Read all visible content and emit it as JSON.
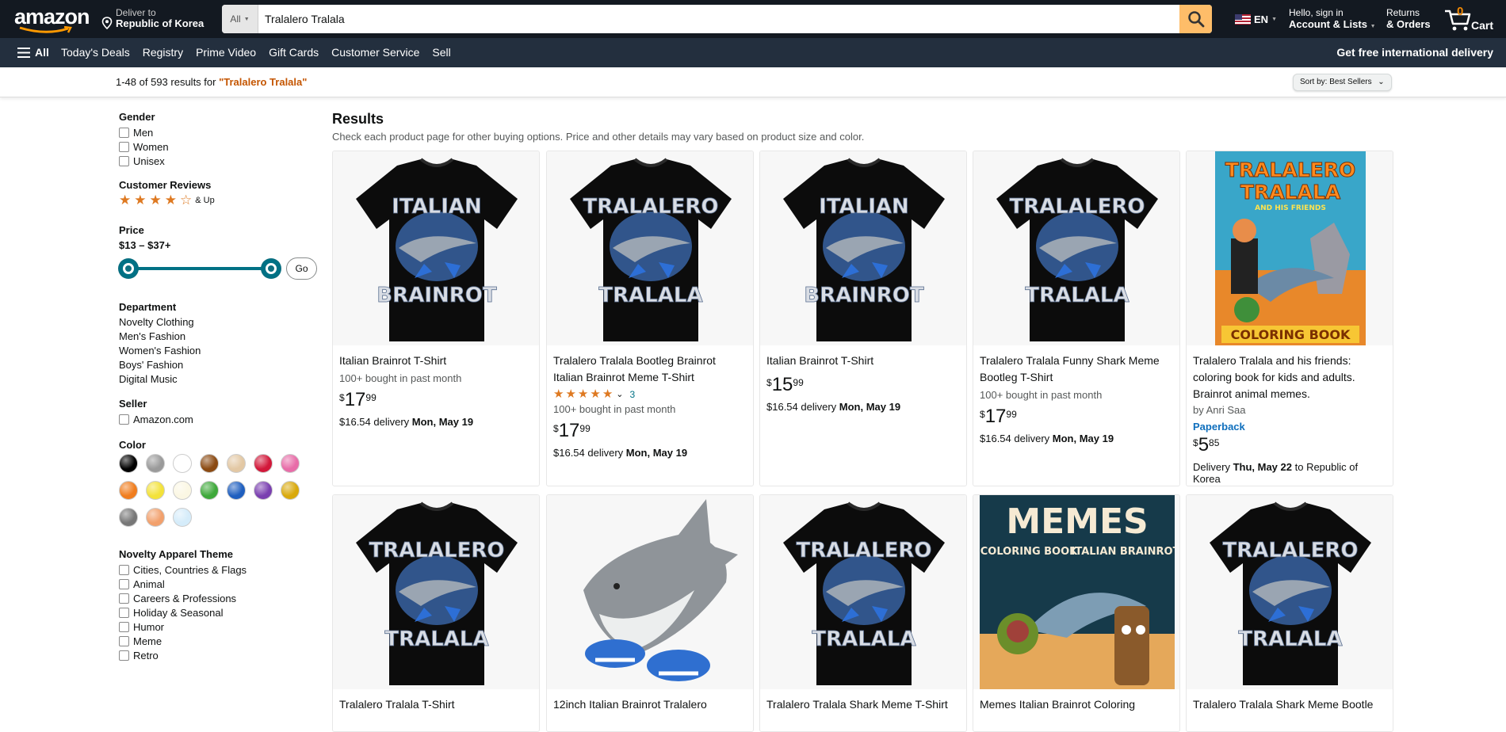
{
  "nav": {
    "logo": "amazon",
    "deliver_line1": "Deliver to",
    "deliver_line2": "Republic of Korea",
    "search_category": "All",
    "search_value": "Tralalero Tralala",
    "lang": "EN",
    "account_line1": "Hello, sign in",
    "account_line2": "Account & Lists",
    "returns_line1": "Returns",
    "returns_line2": "& Orders",
    "cart_count": "0",
    "cart_label": "Cart"
  },
  "subnav": {
    "all": "All",
    "links": [
      "Today's Deals",
      "Registry",
      "Prime Video",
      "Gift Cards",
      "Customer Service",
      "Sell"
    ],
    "promo": "Get free international delivery"
  },
  "results_bar": {
    "count_text": "1-48 of 593 results for ",
    "query": "\"Tralalero Tralala\"",
    "sort_label": "Sort by:",
    "sort_value": "Best Sellers"
  },
  "sidebar": {
    "gender": {
      "title": "Gender",
      "options": [
        "Men",
        "Women",
        "Unisex"
      ]
    },
    "reviews": {
      "title": "Customer Reviews",
      "stars": 4,
      "suffix": "& Up"
    },
    "price": {
      "title": "Price",
      "range": "$13 – $37+",
      "go": "Go"
    },
    "department": {
      "title": "Department",
      "items": [
        "Novelty Clothing",
        "Men's Fashion",
        "Women's Fashion",
        "Boys' Fashion",
        "Digital Music"
      ]
    },
    "seller": {
      "title": "Seller",
      "options": [
        "Amazon.com"
      ]
    },
    "color": {
      "title": "Color",
      "swatches": [
        "#000000",
        "#9a9a9a",
        "#ffffff",
        "#8b4a12",
        "#e3c8a4",
        "#d2183a",
        "#e86ca8",
        "#f07d1e",
        "#f3e23a",
        "#fbf7e3",
        "#3ea83a",
        "#1f5fbf",
        "#7a3fb0",
        "#d9a90c",
        "#777777",
        "#f2a06c",
        "#d5ecfa"
      ]
    },
    "theme": {
      "title": "Novelty Apparel Theme",
      "options": [
        "Cities, Countries & Flags",
        "Animal",
        "Careers & Professions",
        "Holiday & Seasonal",
        "Humor",
        "Meme",
        "Retro"
      ]
    }
  },
  "main": {
    "title": "Results",
    "subtitle": "Check each product page for other buying options. Price and other details may vary based on product size and color."
  },
  "products": [
    {
      "title": "Italian Brainrot T-Shirt",
      "bought": "100+ bought in past month",
      "sym": "$",
      "whole": "17",
      "frac": "99",
      "delivery": "$16.54 delivery ",
      "date": "Mon, May 19",
      "shirt_top": "ITALIAN",
      "shirt_bottom": "BRAINROT"
    },
    {
      "title": "Tralalero Tralala Bootleg Brainrot Italian Brainrot Meme T-Shirt",
      "rating_count": "3",
      "bought": "100+ bought in past month",
      "sym": "$",
      "whole": "17",
      "frac": "99",
      "delivery": "$16.54 delivery ",
      "date": "Mon, May 19",
      "shirt_top": "TRALALERO",
      "shirt_bottom": "TRALALA"
    },
    {
      "title": "Italian Brainrot T-Shirt",
      "sym": "$",
      "whole": "15",
      "frac": "99",
      "delivery": "$16.54 delivery ",
      "date": "Mon, May 19",
      "shirt_top": "ITALIAN",
      "shirt_bottom": "BRAINROT"
    },
    {
      "title": "Tralalero Tralala Funny Shark Meme Bootleg T-Shirt",
      "bought": "100+ bought in past month",
      "sym": "$",
      "whole": "17",
      "frac": "99",
      "delivery": "$16.54 delivery ",
      "date": "Mon, May 19",
      "shirt_top": "TRALALERO",
      "shirt_bottom": "TRALALA"
    },
    {
      "title": "Tralalero Tralala and his friends: coloring book for kids and adults. Brainrot animal memes.",
      "author": "by Anri Saa",
      "format": "Paperback",
      "sym": "$",
      "whole": "5",
      "frac": "85",
      "delivery": "Delivery ",
      "date": "Thu, May 22",
      "delivery_suffix": " to Republic of Korea",
      "book_top": "TRALALERO",
      "book_mid": "TRALALA",
      "book_small": "AND HIS FRIENDS",
      "book_bottom": "COLORING BOOK"
    },
    {
      "title": "Tralalero Tralala T-Shirt",
      "shirt_top": "TRALALERO",
      "shirt_bottom": "TRALALA"
    },
    {
      "title": "12inch Italian Brainrot Tralalero"
    },
    {
      "title": "Tralalero Tralala Shark Meme T-Shirt",
      "shirt_top": "TRALALERO",
      "shirt_bottom": "TRALALA"
    },
    {
      "title": "Memes Italian Brainrot Coloring",
      "book_top": "MEMES",
      "book_left": "COLORING BOOK",
      "book_right": "ITALIAN BRAINROT"
    },
    {
      "title": "Tralalero Tralala Shark Meme Bootle",
      "shirt_top": "TRALALERO",
      "shirt_bottom": "TRALALA"
    }
  ]
}
